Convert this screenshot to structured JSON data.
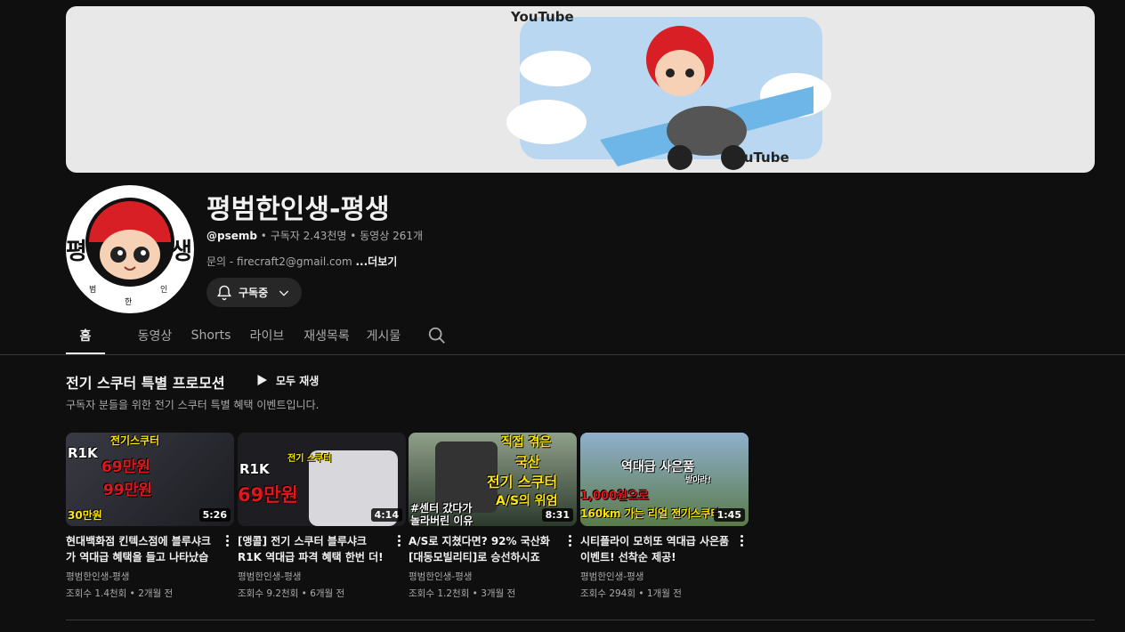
{
  "banner": {
    "logo_text_1": "YouTube",
    "logo_text_2": "YouTube"
  },
  "avatar": {
    "left_char": "평",
    "right_char": "생",
    "bottom_left": "범",
    "bottom_mid": "한",
    "bottom_right": "인"
  },
  "channel": {
    "name": "평범한인생-평생",
    "handle": "@psemb",
    "sep": " • ",
    "subscribers": "구독자 2.43천명",
    "videos": "동영상 261개",
    "description": "문의 - firecraft2@gmail.com ",
    "more_label": "...더보기",
    "subscribe_label": "구독중"
  },
  "tabs": [
    "홈",
    "동영상",
    "Shorts",
    "라이브",
    "재생목록",
    "게시물"
  ],
  "section": {
    "title": "전기 스쿠터 특별 프로모션",
    "play_all": "모두 재생",
    "subtitle": "구독자 분들을 위한 전기 스쿠터 특별 혜택 이벤트입니다."
  },
  "videos": [
    {
      "title": "현대백화점 킨텍스점에 블루샤크가 역대급 혜택을 들고 나타났습니다!",
      "channel": "평범한인생-평생",
      "stats": "조회수 1.4천회 • 2개월 전",
      "duration": "5:26",
      "thumb_texts": [
        "전기스쿠터",
        "R1K",
        "69만원",
        "99만원",
        "30만원"
      ],
      "thumb_color": "#2b2b33"
    },
    {
      "title": "[앵콜] 전기 스쿠터 블루샤크 R1K 역대급 파격 혜택 한번 더!",
      "channel": "평범한인생-평생",
      "stats": "조회수 9.2천회 • 6개월 전",
      "duration": "4:14",
      "thumb_texts": [
        "전기 스쿠터",
        "R1K",
        "69만원"
      ],
      "thumb_color": "#1e1e22"
    },
    {
      "title": "A/S로 지쳤다면? 92% 국산화 [대동모빌리티]로 승선하시죠",
      "channel": "평범한인생-평생",
      "stats": "조회수 1.2천회 • 3개월 전",
      "duration": "8:31",
      "thumb_texts": [
        "직접 겪은",
        "국산",
        "전기 스쿠터",
        "A/S의 위엄",
        "#센터 갔다가",
        "놀라버린 이유"
      ],
      "thumb_color": "#3a4a3a"
    },
    {
      "title": "시티플라이 모히또 역대급 사은품 이벤트! 선착순 제공!",
      "channel": "평범한인생-평생",
      "stats": "조회수 294회 • 1개월 전",
      "duration": "1:45",
      "thumb_texts": [
        "역대급 사은품",
        "받아라!",
        "1,000원으로",
        "160km 가는 리얼 전기스쿠터"
      ],
      "thumb_color": "#6b8aa8"
    }
  ]
}
